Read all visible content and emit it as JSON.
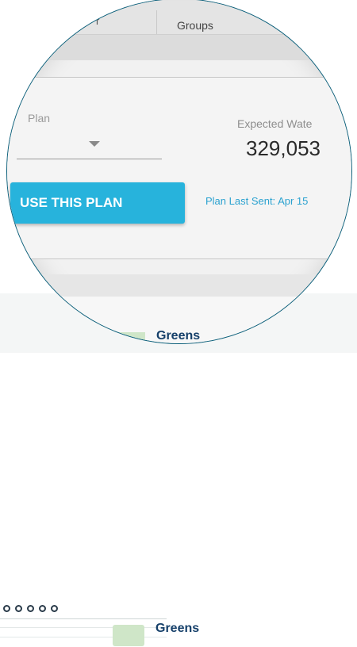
{
  "tabs": {
    "partial_label": "r",
    "groups_label": "Groups"
  },
  "plan": {
    "label": "Plan"
  },
  "expected_water": {
    "label": "Expected Wate",
    "value": "329,053"
  },
  "actions": {
    "use_plan_label": "USE THIS PLAN",
    "plan_last_sent": "Plan Last Sent: Apr 15"
  },
  "background": {
    "section_title": "Greens"
  },
  "colors": {
    "accent": "#27b3dc",
    "link": "#2ba2d0",
    "lens_border": "#0b5f7a",
    "section_title": "#16406a"
  }
}
